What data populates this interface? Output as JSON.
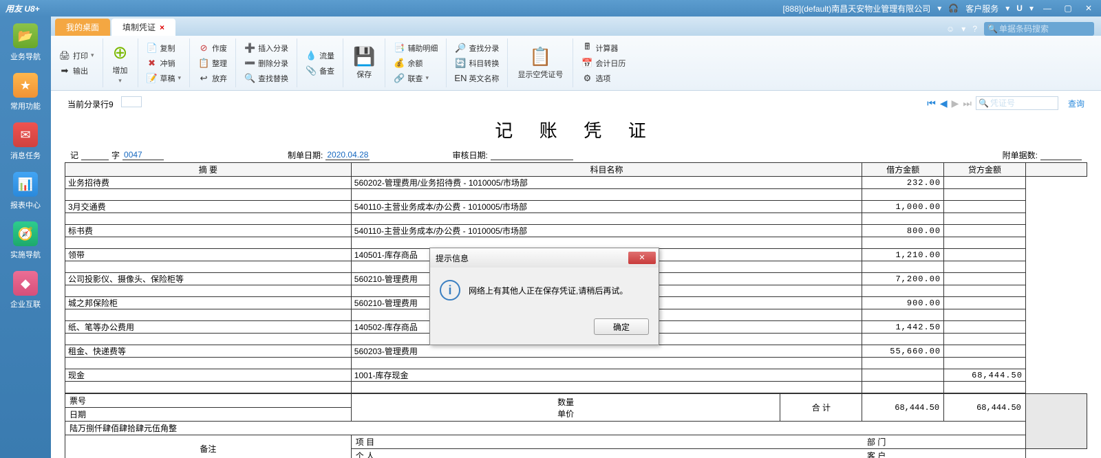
{
  "titlebar": {
    "app": "用友 U8+",
    "account": "[888](default)南昌天安物业管理有限公司",
    "service": "客户服务",
    "u": "U"
  },
  "sidebar": {
    "items": [
      {
        "label": "业务导航"
      },
      {
        "label": "常用功能"
      },
      {
        "label": "消息任务"
      },
      {
        "label": "报表中心"
      },
      {
        "label": "实施导航"
      },
      {
        "label": "企业互联"
      }
    ]
  },
  "tabs": {
    "desktop": "我的桌面",
    "voucher": "填制凭证",
    "search_placeholder": "单据条码搜索"
  },
  "ribbon": {
    "print": "打印",
    "output": "输出",
    "add": "增加",
    "copy": "复制",
    "offset": "冲销",
    "draft": "草稿",
    "void": "作废",
    "arrange": "整理",
    "discard": "放弃",
    "insert": "插入分录",
    "delete": "删除分录",
    "replace": "查找替换",
    "flow": "流量",
    "backup": "备查",
    "save": "保存",
    "aux": "辅助明细",
    "balance": "余额",
    "check": "联查",
    "findentry": "查找分录",
    "subjconv": "科目转换",
    "english": "英文名称",
    "showempty": "显示空凭证号",
    "calc": "计算器",
    "calendar": "会计日历",
    "option": "选项"
  },
  "page": {
    "entry_info": "当前分录行9",
    "nav_placeholder": "凭证号",
    "query": "查询",
    "doc_title": "记 账 凭 证",
    "ji": "记",
    "zi": "字",
    "num": "0047",
    "date_label": "制单日期:",
    "date": "2020.04.28",
    "audit_label": "审核日期:",
    "attach_label": "附单据数:"
  },
  "columns": {
    "summary": "摘 要",
    "subject": "科目名称",
    "debit": "借方金额",
    "credit": "贷方金额"
  },
  "rows": [
    {
      "summary": "业务招待费",
      "subject": "560202-管理费用/业务招待费 - 1010005/市场部",
      "debit": "232.00",
      "credit": ""
    },
    {
      "summary": "3月交通费",
      "subject": "540110-主营业务成本/办公费 - 1010005/市场部",
      "debit": "1,000.00",
      "credit": ""
    },
    {
      "summary": "标书费",
      "subject": "540110-主营业务成本/办公费 - 1010005/市场部",
      "debit": "800.00",
      "credit": ""
    },
    {
      "summary": "领带",
      "subject": "140501-库存商品",
      "debit": "1,210.00",
      "credit": ""
    },
    {
      "summary": "公司投影仪、摄像头、保险柜等",
      "subject": "560210-管理费用",
      "debit": "7,200.00",
      "credit": ""
    },
    {
      "summary": "城之邦保险柜",
      "subject": "560210-管理费用",
      "debit": "900.00",
      "credit": ""
    },
    {
      "summary": "纸、笔等办公费用",
      "subject": "140502-库存商品",
      "debit": "1,442.50",
      "credit": ""
    },
    {
      "summary": "租金、快递费等",
      "subject": "560203-管理费用",
      "debit": "55,660.00",
      "credit": ""
    },
    {
      "summary": "现金",
      "subject": "1001-库存现金",
      "debit": "",
      "credit": "68,444.50"
    }
  ],
  "footer": {
    "piaohao": "票号",
    "riqi": "日期",
    "shuliang": "数量",
    "danjia": "单价",
    "heji": "合  计",
    "debit_total": "68,444.50",
    "credit_total": "68,444.50",
    "amount_words": "陆万捌仟肆佰肆拾肆元伍角整",
    "beizhu": "备注",
    "project": "项  目",
    "person": "个  人",
    "dept": "部  门",
    "customer": "客  户"
  },
  "dialog": {
    "title": "提示信息",
    "message": "网络上有其他人正在保存凭证,请稍后再试。",
    "ok": "确定"
  }
}
